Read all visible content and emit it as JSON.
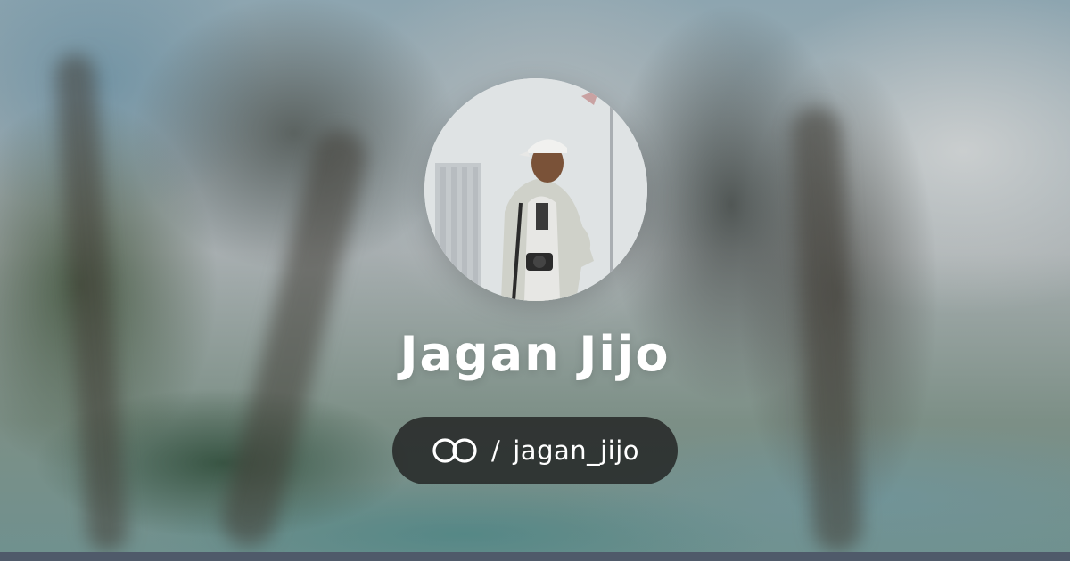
{
  "profile": {
    "name": "Jagan Jijo",
    "separator": "/",
    "handle": "jagan_jijo",
    "avatar_alt": "profile-photo"
  },
  "icons": {
    "brand": "linked-rings-icon"
  },
  "colors": {
    "pill_background": "#1c1c1c",
    "text": "#ffffff",
    "bottom_bar": "#4f5a6a"
  }
}
